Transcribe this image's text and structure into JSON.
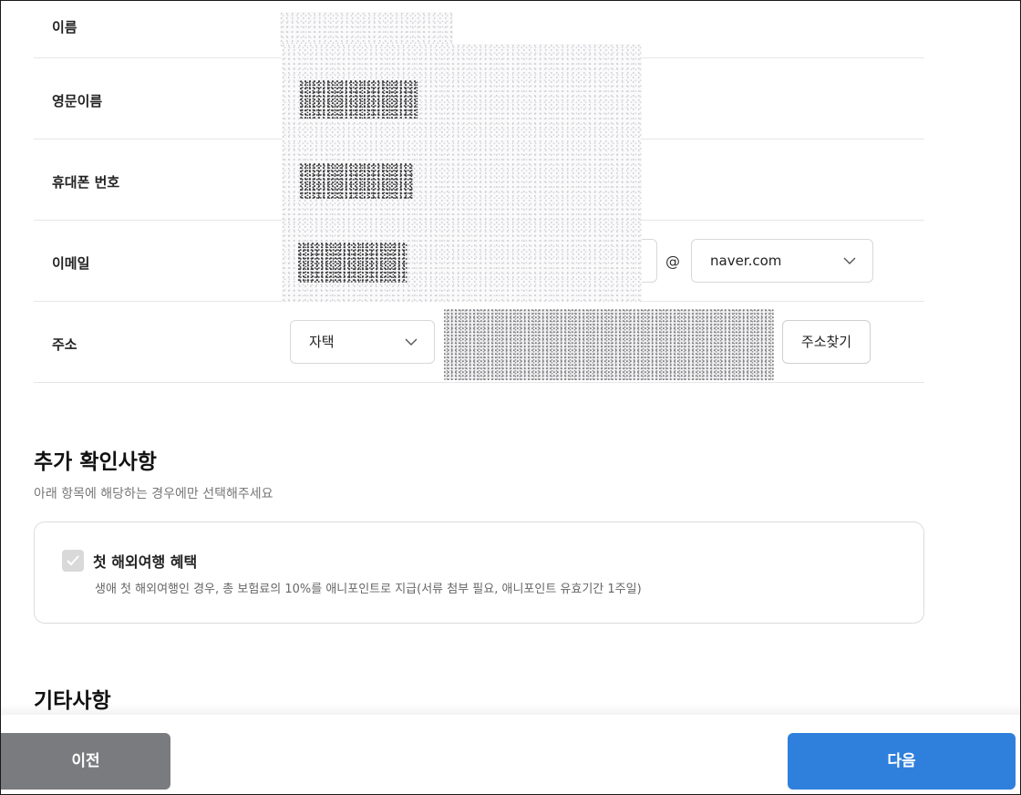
{
  "form": {
    "rows": [
      {
        "label": "이름"
      },
      {
        "label": "영문이름"
      },
      {
        "label": "휴대폰 번호"
      },
      {
        "label": "이메일"
      },
      {
        "label": "주소"
      }
    ],
    "email": {
      "at": "@",
      "domain_selected": "naver.com"
    },
    "address": {
      "type_selected": "자택",
      "search_button": "주소찾기"
    }
  },
  "additional": {
    "title": "추가 확인사항",
    "subtitle": "아래 항목에 해당하는 경우에만 선택해주세요",
    "option": {
      "label": "첫 해외여행 혜택",
      "description": "생애 첫 해외여행인 경우, 총 보험료의 10%를 애니포인트로 지급(서류 첨부 필요, 애니포인트 유효기간 1주일)",
      "checked": false
    }
  },
  "others": {
    "title": "기타사항"
  },
  "footer": {
    "prev_label": "이전",
    "next_label": "다음"
  },
  "colors": {
    "primary": "#2f7fdc",
    "secondary": "#7a7b7e",
    "border": "#d8d8d8"
  }
}
